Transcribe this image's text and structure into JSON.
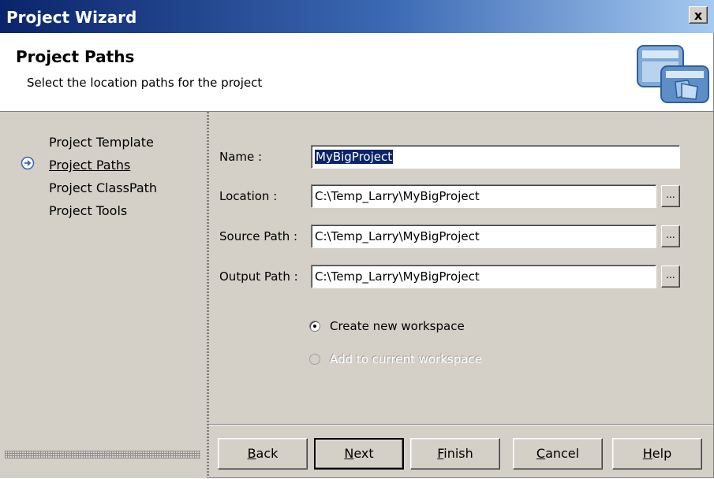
{
  "window": {
    "title": "Project Wizard",
    "close_label": "x"
  },
  "header": {
    "title": "Project Paths",
    "subtitle": "Select the location paths for the project",
    "icon": "wizard-window-icon"
  },
  "sidebar": {
    "items": [
      {
        "label": "Project Template",
        "active": false
      },
      {
        "label": "Project Paths",
        "active": true
      },
      {
        "label": "Project ClassPath",
        "active": false
      },
      {
        "label": "Project Tools",
        "active": false
      }
    ],
    "active_icon": "arrow-right-circle-icon"
  },
  "form": {
    "name": {
      "label": "Name :",
      "value": "MyBigProject"
    },
    "location": {
      "label": "Location :",
      "value": "C:\\Temp_Larry\\MyBigProject",
      "browse": "..."
    },
    "source_path": {
      "label": "Source Path :",
      "value": "C:\\Temp_Larry\\MyBigProject",
      "browse": "..."
    },
    "output_path": {
      "label": "Output Path :",
      "value": "C:\\Temp_Larry\\MyBigProject",
      "browse": "..."
    }
  },
  "workspace": {
    "create_new": {
      "label": "Create new workspace",
      "checked": true,
      "enabled": true
    },
    "add_current": {
      "label": "Add to current workspace",
      "checked": false,
      "enabled": false
    }
  },
  "buttons": {
    "back": {
      "first": "B",
      "rest": "ack"
    },
    "next": {
      "first": "N",
      "rest": "ext"
    },
    "finish": {
      "first": "F",
      "rest": "inish"
    },
    "cancel": {
      "first": "C",
      "rest": "ancel"
    },
    "help": {
      "first": "H",
      "rest": "elp"
    }
  },
  "colors": {
    "title_bar": "#0a246a",
    "selection": "#0a246a",
    "face": "#d4d0c8"
  }
}
